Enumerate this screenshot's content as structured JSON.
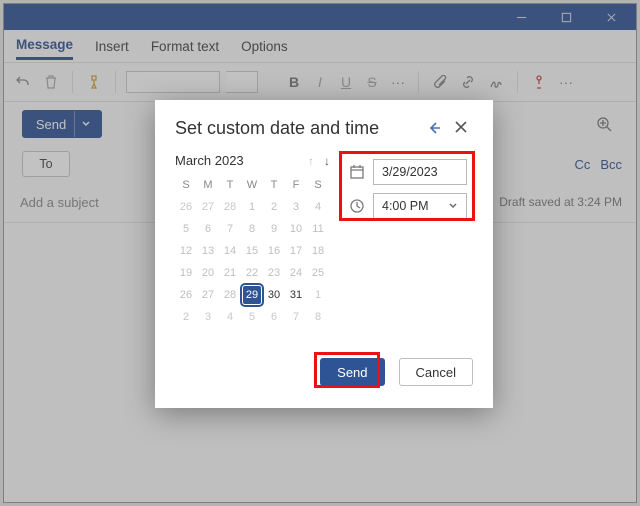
{
  "titlebar": {
    "min": "minimize",
    "max": "maximize",
    "close": "close"
  },
  "tabs": [
    "Message",
    "Insert",
    "Format text",
    "Options"
  ],
  "active_tab": 0,
  "ribbon": {
    "bold": "B",
    "italic": "I",
    "underline": "U",
    "strike": "S"
  },
  "send_button": "Send",
  "to_button": "To",
  "cc_link": "Cc",
  "bcc_link": "Bcc",
  "subject_placeholder": "Add a subject",
  "draft_status": "Draft saved at 3:24 PM",
  "modal": {
    "title": "Set custom date and time",
    "month_label": "March 2023",
    "dow": [
      "S",
      "M",
      "T",
      "W",
      "T",
      "F",
      "S"
    ],
    "rows": [
      [
        "26",
        "27",
        "28",
        "1",
        "2",
        "3",
        "4"
      ],
      [
        "5",
        "6",
        "7",
        "8",
        "9",
        "10",
        "11"
      ],
      [
        "12",
        "13",
        "14",
        "15",
        "16",
        "17",
        "18"
      ],
      [
        "19",
        "20",
        "21",
        "22",
        "23",
        "24",
        "25"
      ],
      [
        "26",
        "27",
        "28",
        "29",
        "30",
        "31",
        "1"
      ],
      [
        "2",
        "3",
        "4",
        "5",
        "6",
        "7",
        "8"
      ]
    ],
    "selected": "29",
    "date_value": "3/29/2023",
    "time_value": "4:00 PM",
    "send": "Send",
    "cancel": "Cancel"
  }
}
